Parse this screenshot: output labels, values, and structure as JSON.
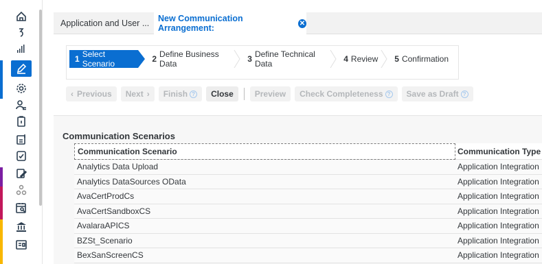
{
  "tabs": {
    "first_label": "Application and User ...",
    "second_label": "New Communication Arrangement:",
    "close_glyph": "✕"
  },
  "wizard": {
    "steps": [
      {
        "num": "1",
        "label": "Select Scenario"
      },
      {
        "num": "2",
        "label": "Define Business Data"
      },
      {
        "num": "3",
        "label": "Define Technical Data"
      },
      {
        "num": "4",
        "label": "Review"
      },
      {
        "num": "5",
        "label": "Confirmation"
      }
    ]
  },
  "toolbar": {
    "previous": "Previous",
    "next": "Next",
    "finish": "Finish",
    "close": "Close",
    "preview": "Preview",
    "check": "Check Completeness",
    "draft": "Save as Draft",
    "help_glyph": "?",
    "prev_glyph": "‹",
    "next_glyph": "›"
  },
  "section": {
    "title": "Communication Scenarios",
    "columns": [
      "Communication Scenario",
      "Communication Type"
    ],
    "rows": [
      [
        "Analytics Data Upload",
        "Application Integration"
      ],
      [
        "Analytics DataSources OData",
        "Application Integration"
      ],
      [
        "AvaCertProdCs",
        "Application Integration"
      ],
      [
        "AvaCertSandboxCS",
        "Application Integration"
      ],
      [
        "AvalaraAPICS",
        "Application Integration"
      ],
      [
        "BZSt_Scenario",
        "Application Integration"
      ],
      [
        "BexSanScreenCS",
        "Application Integration"
      ]
    ]
  },
  "colors": {
    "accent": "#0a6ed1",
    "stripe_blue": "#0a6ed1",
    "stripe_purple": "#7b1fa2",
    "stripe_magenta": "#c2185b",
    "stripe_yellow": "#f9b700"
  },
  "sidebar_icons": [
    "home-icon",
    "refresh-icon",
    "analytics-icon",
    "edit-icon",
    "settings-icon",
    "user-list-icon",
    "clipboard-icon",
    "money-icon",
    "check-icon",
    "form-icon",
    "network-icon",
    "calendar-search-icon",
    "bank-icon",
    "id-card-icon"
  ]
}
